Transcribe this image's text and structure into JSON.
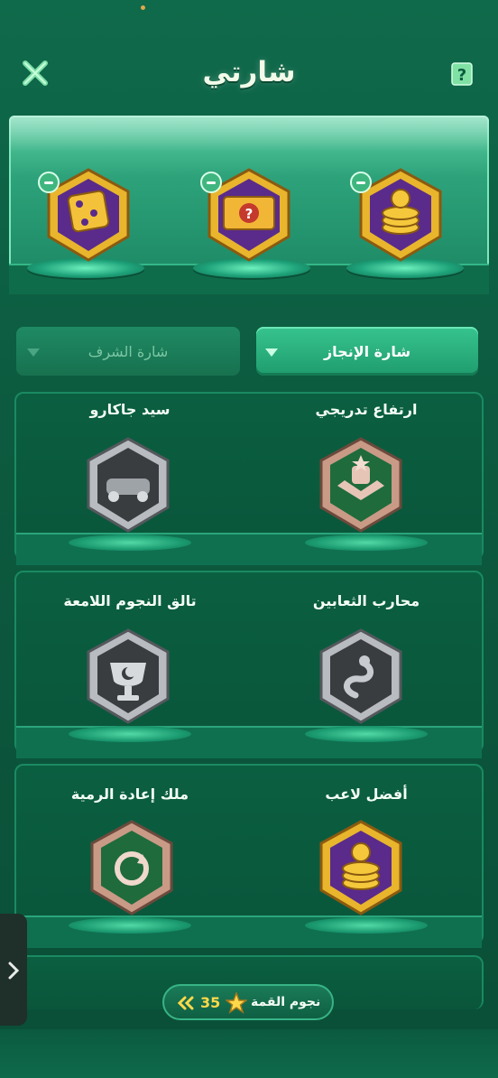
{
  "header": {
    "title": "شارتي",
    "close_icon": "close-icon",
    "help_icon": "help-icon",
    "help_symbol": "?"
  },
  "showcase": {
    "badges": [
      {
        "name": "coins-badge",
        "icon": "coins-icon"
      },
      {
        "name": "mystery-chest-badge",
        "icon": "question-chest-icon",
        "symbol": "?"
      },
      {
        "name": "dice-badge",
        "icon": "dice-icon"
      }
    ]
  },
  "tabs": {
    "active": {
      "label": "شارة الإنجاز"
    },
    "inactive": {
      "label": "شارة الشرف"
    }
  },
  "badges": [
    {
      "label": "ارتفاع تدريجي",
      "icon": "trophy-wings-icon",
      "tier": "bronze"
    },
    {
      "label": "سيد جاكارو",
      "icon": "race-car-icon",
      "tier": "silver"
    },
    {
      "label": "محارب الثعابين",
      "icon": "snake-icon",
      "tier": "silver"
    },
    {
      "label": "تالق النجوم اللامعة",
      "icon": "trophy-moon-icon",
      "tier": "silver"
    },
    {
      "label": "أفضل لاعب",
      "icon": "coins-icon",
      "tier": "gold"
    },
    {
      "label": "ملك إعادة الرمية",
      "icon": "replay-icon",
      "tier": "bronze"
    }
  ],
  "footer": {
    "stars_label": "نجوم القمة",
    "stars_value": "35",
    "star_icon": "star-icon",
    "arrow_icon": "double-chevron-icon",
    "side_tab_icon": "chevron-right-icon"
  },
  "colors": {
    "background": "#0c5a3f",
    "accent": "#37c48e",
    "gold": "#e8b52c",
    "purple": "#5a2b8a",
    "silver": "#b8bcc0",
    "bronze": "#c99a86"
  }
}
